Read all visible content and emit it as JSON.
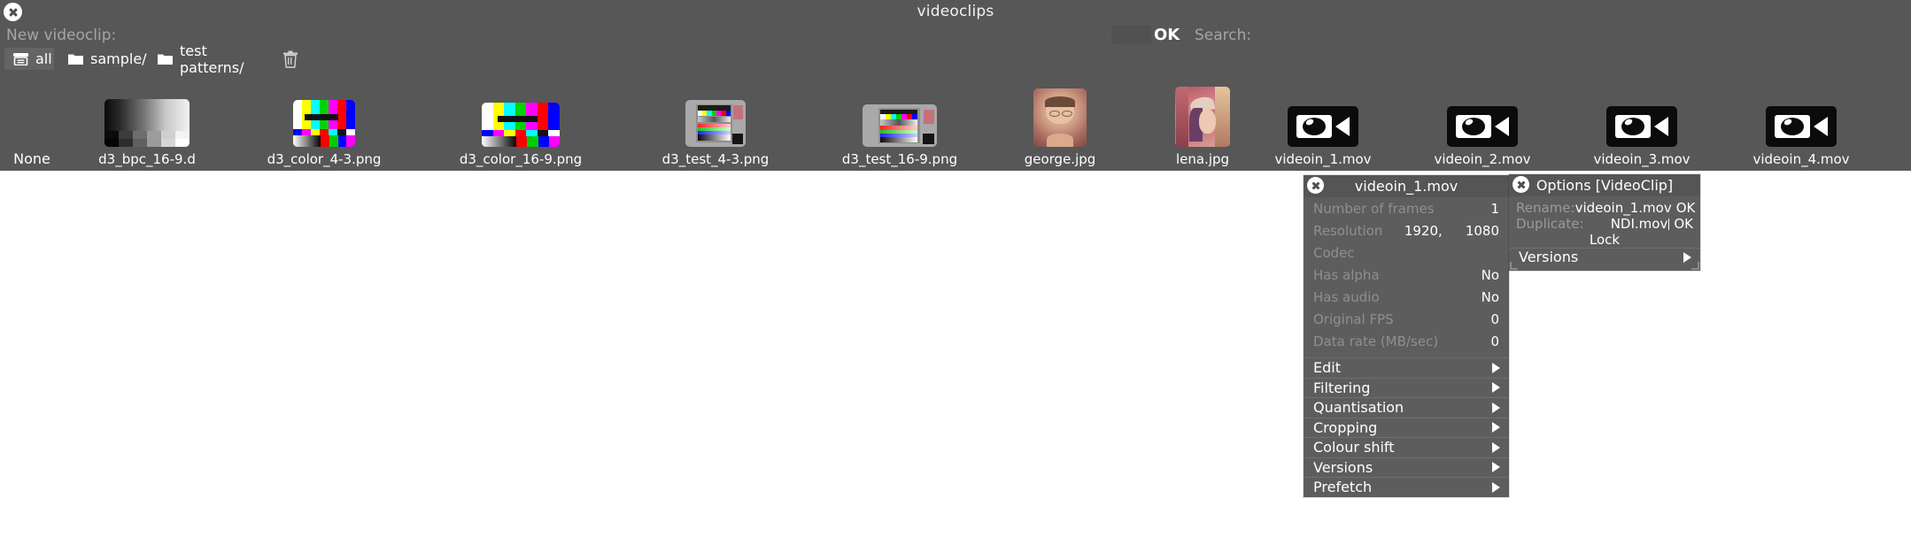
{
  "window": {
    "title": "videoclips",
    "close_icon": "close-icon",
    "new_clip_label": "New videoclip:",
    "ok_label": "OK",
    "search_label": "Search:",
    "search_value": ""
  },
  "folders": [
    {
      "label": "all",
      "icon": "archive-icon",
      "selected": true
    },
    {
      "label": "sample/",
      "icon": "folder-icon",
      "selected": false
    },
    {
      "label": "test patterns/",
      "icon": "folder-icon",
      "selected": false
    }
  ],
  "trash": {
    "icon": "trash-icon",
    "label": ""
  },
  "clips": [
    {
      "label": "None",
      "kind": "none"
    },
    {
      "label": "d3_bpc_16-9.d",
      "kind": "grayramp",
      "ratio": "16-9"
    },
    {
      "label": "d3_color_4-3.png",
      "kind": "colorbars",
      "ratio": "4-3"
    },
    {
      "label": "d3_color_16-9.png",
      "kind": "colorbars",
      "ratio": "16-9"
    },
    {
      "label": "d3_test_4-3.png",
      "kind": "testchart",
      "ratio": "4-3"
    },
    {
      "label": "d3_test_16-9.png",
      "kind": "testchart",
      "ratio": "16-9"
    },
    {
      "label": "george.jpg",
      "kind": "photo-george"
    },
    {
      "label": "lena.jpg",
      "kind": "photo-lena"
    },
    {
      "label": "videoin_1.mov",
      "kind": "camera"
    },
    {
      "label": "videoin_2.mov",
      "kind": "camera"
    },
    {
      "label": "videoin_3.mov",
      "kind": "camera"
    },
    {
      "label": "videoin_4.mov",
      "kind": "camera"
    }
  ],
  "info_panel": {
    "title": "videoin_1.mov",
    "close_icon": "close-icon",
    "rows": [
      {
        "key": "Number of frames",
        "value": "1"
      },
      {
        "key": "Resolution",
        "value": "1080",
        "value2": "1920,"
      },
      {
        "key": "Codec",
        "value": ""
      },
      {
        "key": "Has alpha",
        "value": "No"
      },
      {
        "key": "Has audio",
        "value": "No"
      },
      {
        "key": "Original FPS",
        "value": "0"
      },
      {
        "key": "Data rate (MB/sec)",
        "value": "0"
      }
    ],
    "menu": [
      {
        "label": "Edit",
        "arrow": "submenu-arrow-icon"
      },
      {
        "label": "Filtering",
        "arrow": "submenu-arrow-icon"
      },
      {
        "label": "Quantisation",
        "arrow": "submenu-arrow-icon"
      },
      {
        "label": "Cropping",
        "arrow": "submenu-arrow-icon"
      },
      {
        "label": "Colour shift",
        "arrow": "submenu-arrow-icon"
      },
      {
        "label": "Versions",
        "arrow": "submenu-arrow-icon"
      },
      {
        "label": "Prefetch",
        "arrow": "submenu-arrow-icon"
      }
    ]
  },
  "options_panel": {
    "title": "Options [VideoClip]",
    "close_icon": "close-icon",
    "rename_label": "Rename:",
    "rename_value": "videoin_1.mov",
    "rename_ok": "OK",
    "duplicate_label": "Duplicate:",
    "duplicate_value": "NDI.mov",
    "duplicate_ok": "OK",
    "lock_label": "Lock",
    "versions_label": "Versions",
    "versions_arrow": "submenu-arrow-icon"
  },
  "colors": {
    "window_bg": "#575757",
    "panel_bg": "#5d5d5d",
    "panel_title_bg": "#555555",
    "text": "#ffffff",
    "text_dim": "#9a9a9a",
    "selected_tab": "#646464",
    "desktop": "#ffffff"
  }
}
